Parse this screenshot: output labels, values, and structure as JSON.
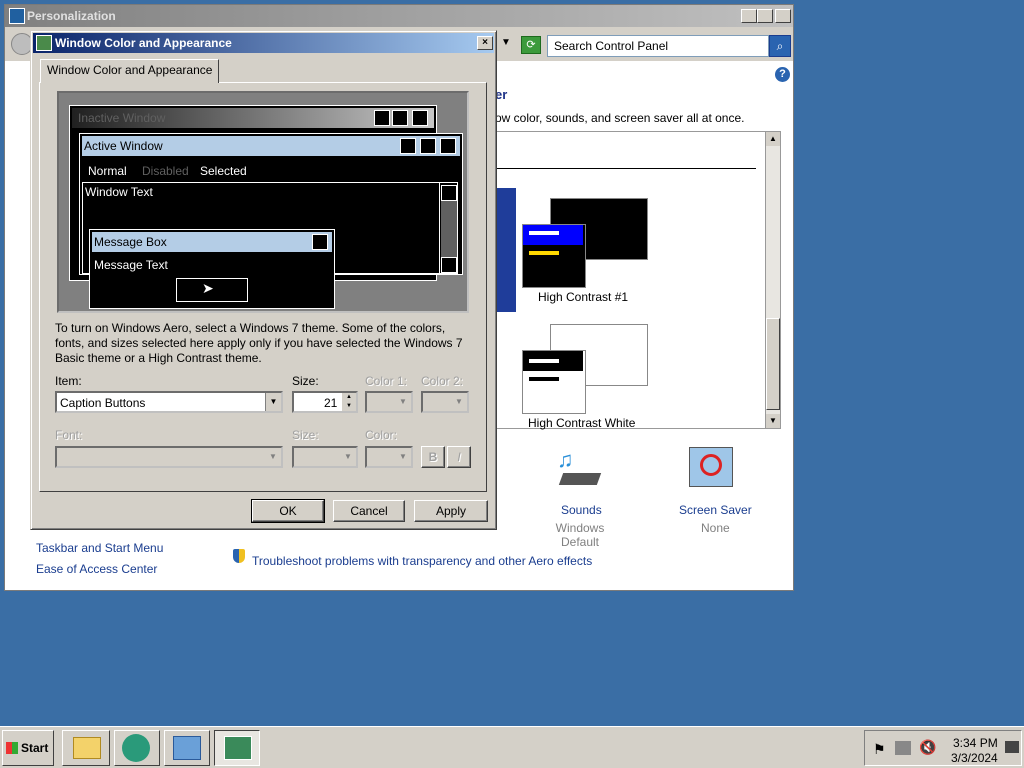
{
  "personalization": {
    "title": "Personalization",
    "search_placeholder": "Search Control Panel",
    "heading_fragment": "er",
    "description_fragment": "ow color, sounds, and screen saver all at once.",
    "themes": [
      {
        "label": "High Contrast #1"
      },
      {
        "label": "High Contrast White"
      }
    ],
    "bottom_items": [
      {
        "label": "Sounds",
        "sub": "Windows Default"
      },
      {
        "label": "Screen Saver",
        "sub": "None"
      }
    ],
    "see_also": [
      "Taskbar and Start Menu",
      "Ease of Access Center"
    ],
    "troubleshoot": "Troubleshoot problems with transparency and other Aero effects"
  },
  "dialog": {
    "title": "Window Color and Appearance",
    "tab": "Window Color and Appearance",
    "preview": {
      "inactive": "Inactive Window",
      "active": "Active Window",
      "menu": [
        "Normal",
        "Disabled",
        "Selected"
      ],
      "window_text": "Window Text",
      "message_box": "Message Box",
      "message_text": "Message Text"
    },
    "info": "To turn on Windows Aero, select a Windows 7 theme.  Some of the colors, fonts, and sizes selected here apply only if you have selected the Windows 7 Basic theme or a High Contrast theme.",
    "item_label": "Item:",
    "item_value": "Caption Buttons",
    "size_label": "Size:",
    "size_value": "21",
    "color1_label": "Color 1:",
    "color2_label": "Color 2:",
    "font_label": "Font:",
    "font_size_label": "Size:",
    "font_color_label": "Color:",
    "bold": "B",
    "italic": "I",
    "ok": "OK",
    "cancel": "Cancel",
    "apply": "Apply"
  },
  "taskbar": {
    "start": "Start",
    "time": "3:34 PM",
    "date": "3/3/2024"
  },
  "colors": {
    "desktop": "#3a6ea5",
    "active_title": "#0a246a",
    "hc_blue": "#0000ff",
    "hc_yellow": "#ffd700"
  }
}
